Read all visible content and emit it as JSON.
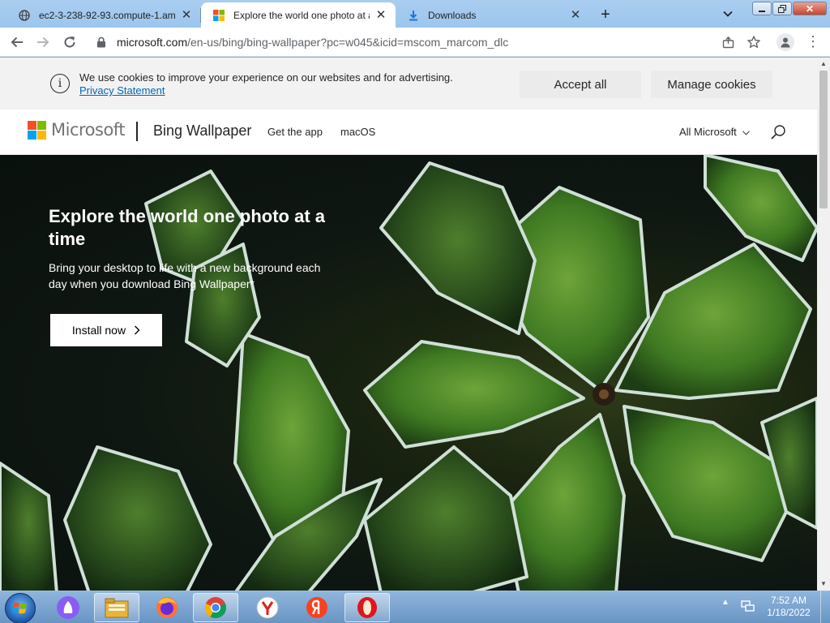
{
  "browser": {
    "tabs": [
      {
        "title": "ec2-3-238-92-93.compute-1.ama",
        "favicon": "globe-icon",
        "active": false
      },
      {
        "title": "Explore the world one photo at a",
        "favicon": "microsoft-icon",
        "active": true
      },
      {
        "title": "Downloads",
        "favicon": "download-icon",
        "active": false
      }
    ],
    "new_tab": "+",
    "close_glyph": "✕",
    "url_host": "microsoft.com",
    "url_path": "/en-us/bing/bing-wallpaper?pc=w045&icid=mscom_marcom_dlc"
  },
  "cookie_banner": {
    "message": "We use cookies to improve your experience on our websites and for advertising.",
    "privacy_link": "Privacy Statement",
    "accept_label": "Accept all",
    "manage_label": "Manage cookies"
  },
  "header": {
    "logo_text": "Microsoft",
    "brand": "Bing Wallpaper",
    "nav": [
      "Get the app",
      "macOS"
    ],
    "all_microsoft": "All Microsoft"
  },
  "hero": {
    "heading": "Explore the world one photo at a time",
    "body": "Bring your desktop to life with a new background each day when you download Bing Wallpaper*",
    "cta_label": "Install now"
  },
  "taskbar": {
    "apps": [
      "file-explorer-icon",
      "firefox-icon",
      "chrome-icon",
      "yandex-browser-icon",
      "yandex-icon",
      "opera-icon"
    ],
    "time": "7:52 AM",
    "date": "1/18/2022"
  },
  "colors": {
    "ms_red": "#f25022",
    "ms_green": "#7fba00",
    "ms_blue": "#00a4ef",
    "ms_yellow": "#ffb900",
    "link": "#0067b8"
  }
}
